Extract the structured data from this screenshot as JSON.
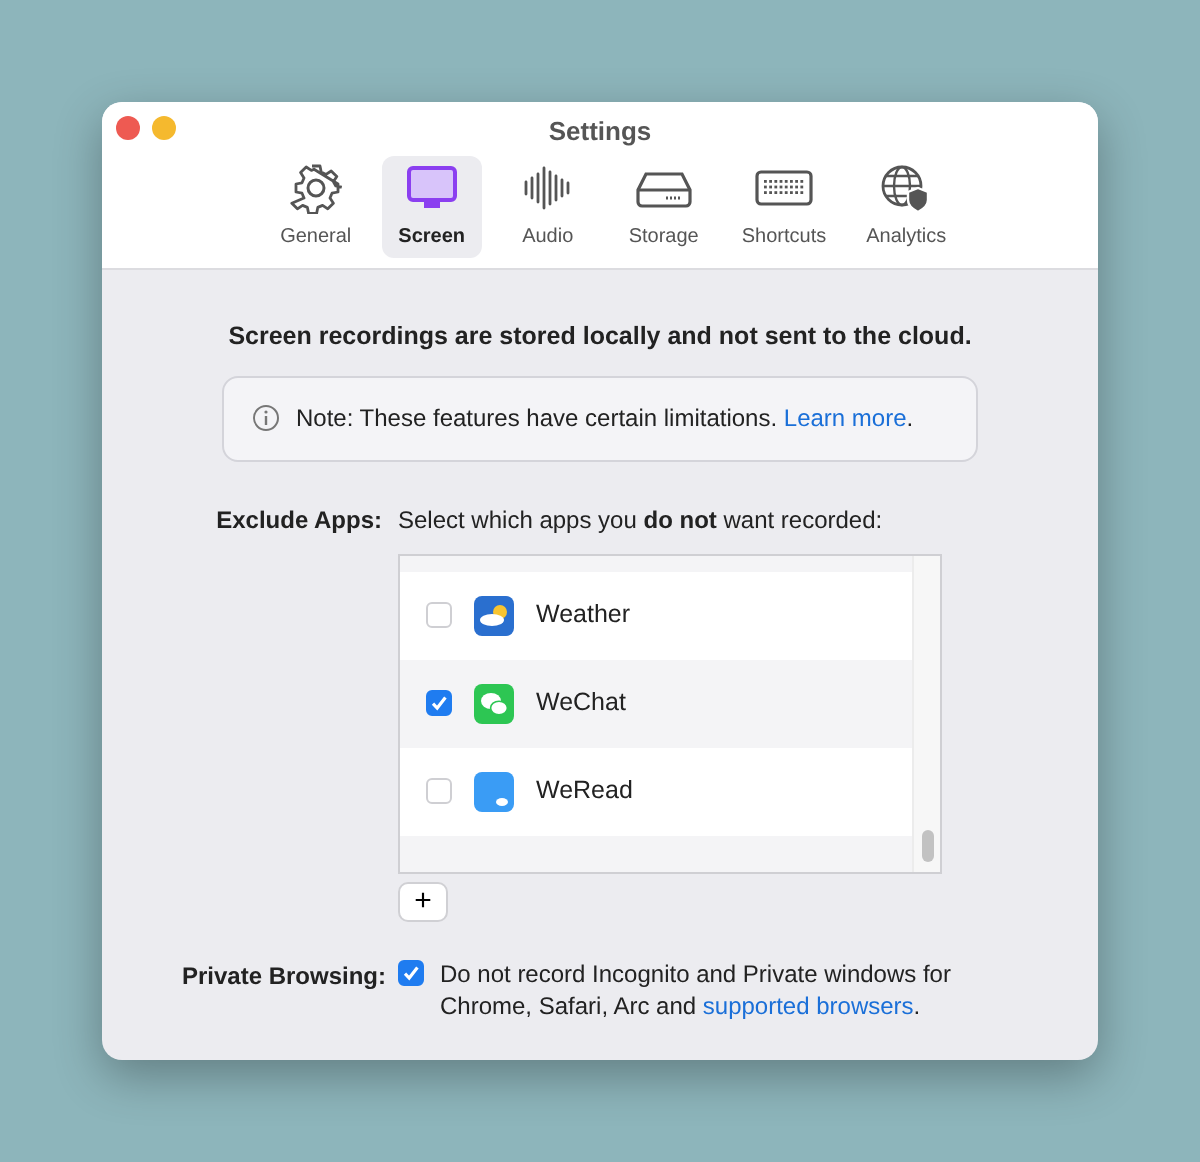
{
  "window": {
    "title": "Settings"
  },
  "tabs": [
    {
      "label": "General",
      "selected": false
    },
    {
      "label": "Screen",
      "selected": true
    },
    {
      "label": "Audio",
      "selected": false
    },
    {
      "label": "Storage",
      "selected": false
    },
    {
      "label": "Shortcuts",
      "selected": false
    },
    {
      "label": "Analytics",
      "selected": false
    }
  ],
  "heading": "Screen recordings are stored locally and not sent to the cloud.",
  "note": {
    "text": "Note: These features have certain limitations. ",
    "link": "Learn more",
    "after": "."
  },
  "exclude_apps": {
    "label": "Exclude Apps:",
    "description": "Select which apps you **do not** want recorded:",
    "apps": [
      {
        "name": "Weather",
        "checked": false
      },
      {
        "name": "WeChat",
        "checked": true
      },
      {
        "name": "WeRead",
        "checked": false
      }
    ],
    "add_button": "+"
  },
  "private_browsing": {
    "label": "Private Browsing:",
    "checked": true,
    "text": "Do not record Incognito and Private windows for Chrome, Safari, Arc and ",
    "link": "supported browsers",
    "after": "."
  }
}
